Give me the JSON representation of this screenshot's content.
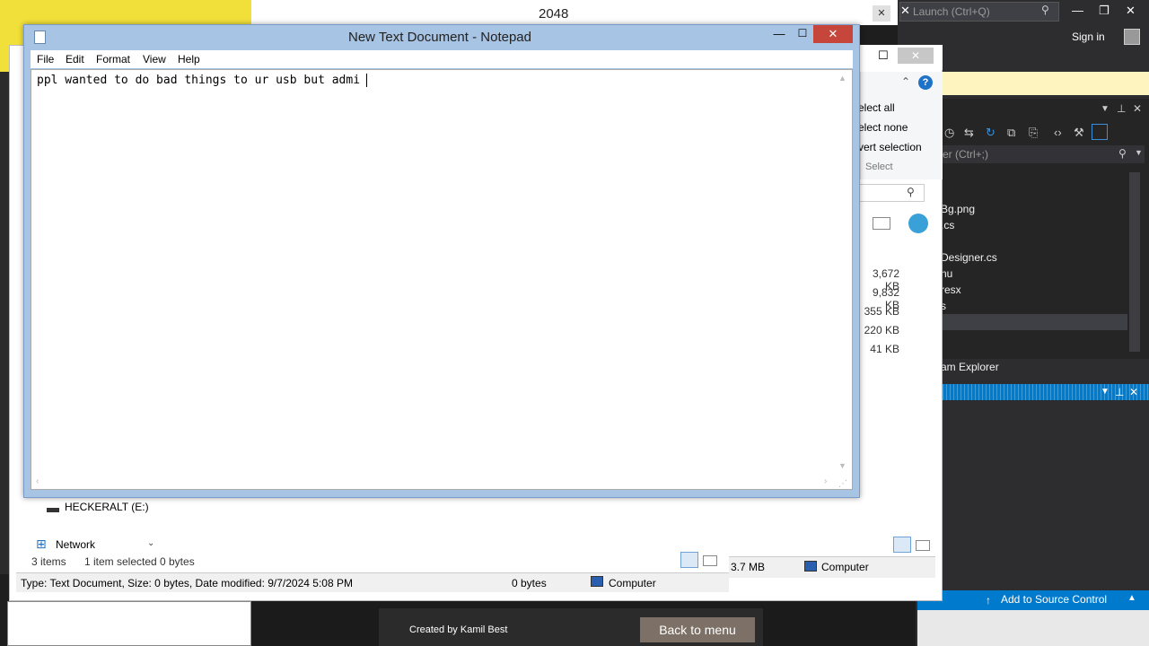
{
  "notepad": {
    "title": "New Text Document - Notepad",
    "menu": [
      "File",
      "Edit",
      "Format",
      "View",
      "Help"
    ],
    "content": "ppl wanted to do bad things to ur usb but admi",
    "minimize_glyph": "—",
    "maximize_glyph": "☐",
    "close_glyph": "✕"
  },
  "game": {
    "title": "2048",
    "credit": "Created by Kamil Best",
    "back_button": "Back to menu",
    "close_glyph": "✕"
  },
  "explorer": {
    "ribbon": [
      "elect all",
      "elect none",
      "vert selection"
    ],
    "ribbon_group": "Select",
    "sizes": [
      "3,672 KB",
      "9,832 KB",
      "355 KB",
      "220 KB",
      "41 KB"
    ],
    "nav_drive": "HECKERALT (E:)",
    "nav_network": "Network",
    "status_items": "3 items",
    "status_selected": "1 item selected",
    "status_bytes": "0 bytes",
    "detail_type": "Type: Text Document, Size: 0 bytes, Date modified: 9/7/2024 5:08 PM",
    "detail_bytes": "0 bytes",
    "detail_location": "Computer",
    "second_size": "3.7 MB",
    "second_location": "Computer"
  },
  "visual_studio": {
    "quick_launch": "Launch (Ctrl+Q)",
    "sign_in": "Sign in",
    "search_placeholder": "er (Ctrl+;)",
    "files": [
      "Bg.png",
      ".cs",
      "Designer.cs",
      "nu",
      "resx",
      "s"
    ],
    "team_explorer": "am Explorer",
    "add_to_source_control": "Add to Source Control"
  }
}
